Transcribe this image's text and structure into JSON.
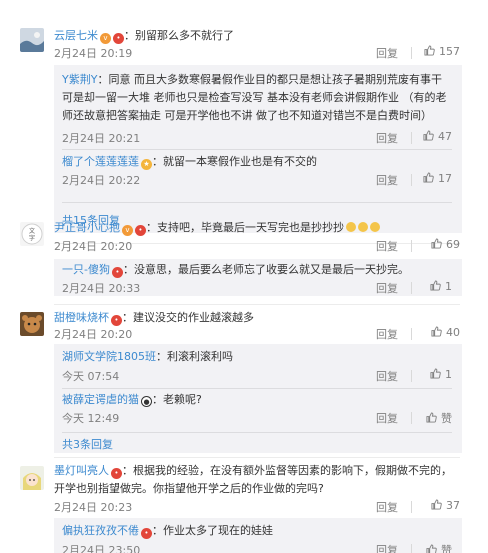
{
  "labels": {
    "reply": "回复",
    "like_zan": "赞"
  },
  "comments": [
    {
      "user": "云层七米",
      "text": "：别留那么多不就行了",
      "time": "2月24日 20:19",
      "likes": "157",
      "replies": [
        {
          "user": "Y紫荆Y",
          "text": "：同意 而且大多数寒假暑假作业目的都只是想让孩子暑期别荒废有事干 可是却一留一大堆 老师也只是检查写没写 基本没有老师会讲假期作业 （有的老师还故意把答案抽走 可是开学他也不讲 做了也不知道对错岂不是白费时间）",
          "time": "2月24日 20:21",
          "likes": "47"
        },
        {
          "user": "榴了个莲莲莲莲",
          "text": "：就留一本寒假作业也是有不交的",
          "time": "2月24日 20:22",
          "likes": "17"
        }
      ],
      "more": "共15条回复"
    },
    {
      "user": "尹正哥小心抱",
      "text": "：支持吧，毕竟最后一天写完也是抄抄抄",
      "time": "2月24日 20:20",
      "likes": "69",
      "replies": [
        {
          "user": "一只-傻狗",
          "text": "：没意思，最后要么老师忘了收要么就又是最后一天抄完。",
          "time": "2月24日 20:33",
          "likes": "1"
        }
      ]
    },
    {
      "user": "甜橙味烧杯",
      "text": "：建议没交的作业越滚越多",
      "time": "2月24日 20:20",
      "likes": "40",
      "replies": [
        {
          "user": "湖师文学院1805班",
          "text": "：利滚利滚利吗",
          "time": "今天 07:54",
          "likes": "1"
        },
        {
          "user": "被薛定谔虐的猫",
          "text": "：老赖呢?",
          "time": "今天 12:49",
          "likes": "赞"
        }
      ],
      "more": "共3条回复"
    },
    {
      "user": "墨灯叫亮人",
      "text": "：根据我的经验，在没有额外监督等因素的影响下，假期做不完的，开学也别指望做完。你指望他开学之后的作业做的完吗?",
      "time": "2月24日 20:23",
      "likes": "37",
      "replies": [
        {
          "user": "偏执狂孜孜不倦",
          "text": "：作业太多了现在的娃娃",
          "time": "2月24日 23:50",
          "likes": "赞"
        }
      ]
    }
  ],
  "colors": {
    "username": "#eb7350",
    "link": "#3d8acf",
    "reply_bg": "#f2f2f5",
    "meta": "#808080"
  },
  "icons": [
    "avatar",
    "vip-badge-icon",
    "fire-badge-icon",
    "thumbs-up-icon",
    "panda-icon",
    "emoji-icon"
  ]
}
